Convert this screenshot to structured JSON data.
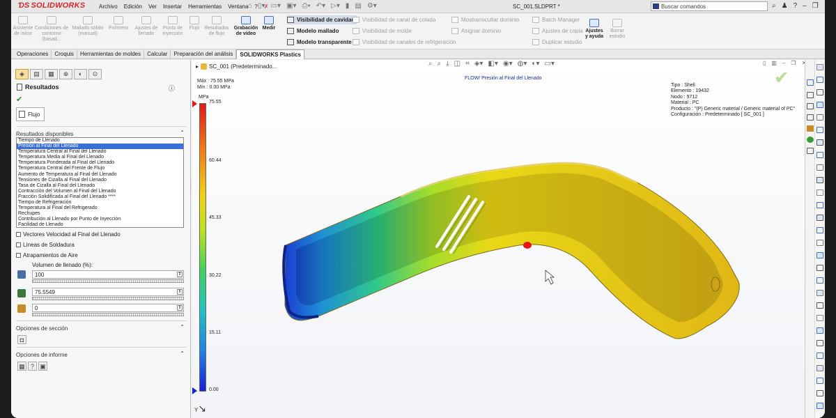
{
  "app": {
    "logo": "SOLIDWORKS",
    "menus": [
      "Archivo",
      "Edición",
      "Ver",
      "Insertar",
      "Herramientas",
      "Ventana",
      "?"
    ],
    "document_title": "SC_001.SLDPRT *",
    "command_search_placeholder": "Buscar comandos"
  },
  "ribbon": {
    "large_buttons": [
      {
        "label": "Asistente de inicio",
        "enabled": false
      },
      {
        "label": "Condiciones de contorno (basad...",
        "enabled": false
      },
      {
        "label": "Mallado sólido (manual)",
        "enabled": false
      },
      {
        "label": "Polímero",
        "enabled": false
      },
      {
        "label": "Ajustes de llenado",
        "enabled": false
      },
      {
        "label": "Punto de inyección",
        "enabled": false
      },
      {
        "label": "Flujo",
        "enabled": false
      },
      {
        "label": "Resultados de flujo",
        "enabled": false
      },
      {
        "label": "Grabación de vídeo",
        "enabled": true
      },
      {
        "label": "Medir",
        "enabled": true
      }
    ],
    "display_options": [
      {
        "label": "Visibilidad de cavidad",
        "enabled": true,
        "selected": true
      },
      {
        "label": "Modelo mallado",
        "enabled": true
      },
      {
        "label": "Modelo transparente",
        "enabled": true
      }
    ],
    "visibility_options": [
      {
        "label": "Visibilidad de canal de colada",
        "enabled": false
      },
      {
        "label": "Visibilidad de molde",
        "enabled": false
      },
      {
        "label": "Visibilidad de canales de refrigeración",
        "enabled": false
      }
    ],
    "domain_options": [
      {
        "label": "Mostrar/ocultar dominio",
        "enabled": false
      },
      {
        "label": "Asignar dominio",
        "enabled": false
      }
    ],
    "batch_options": [
      {
        "label": "Batch Manager",
        "enabled": false
      },
      {
        "label": "Ajustes de copia",
        "enabled": false
      },
      {
        "label": "Duplicar estudio",
        "enabled": false
      }
    ],
    "right_buttons": [
      {
        "label": "Ajustes y ayuda",
        "enabled": true
      },
      {
        "label": "Borrar estudio",
        "enabled": false
      }
    ]
  },
  "tabs": [
    {
      "label": "Operaciones",
      "active": false
    },
    {
      "label": "Croquis",
      "active": false
    },
    {
      "label": "Herramientas de moldes",
      "active": false
    },
    {
      "label": "Calcular",
      "active": false
    },
    {
      "label": "Preparación del análisis",
      "active": false
    },
    {
      "label": "SOLIDWORKS Plastics",
      "active": true
    }
  ],
  "panel": {
    "title": "Resultados",
    "help_icon": "question-icon",
    "ok_icon": "check-icon",
    "flow_tab": "Flujo",
    "results_section": "Resultados disponibles",
    "results": [
      "Tiempo de Llenado",
      "Presión al Final del Llenado",
      "Temperatura Central al Final del Llenado",
      "Temperatura Media al Final del Llenado",
      "Temperatura Ponderada al Final del Llenado",
      "Temperatura Central del Frente de Flujo",
      "Aumento de Temperatura al Final del Llenado",
      "Tensiones de Cizalla al Final del Llenado",
      "Tasa de Cizalla al Final del Llenado",
      "Contracción del Volumen al Final del Llenado",
      "Fracción Solidificada al Final del Llenado ****",
      "Tiempo de Refrigeración",
      "Temperatura al Final del Refrigerado",
      "Rechupes",
      "Contribución al Llenado por Punto de Inyección",
      "Facilidad de Llenado"
    ],
    "selected_result_index": 1,
    "checkboxes": [
      {
        "label": "Vectores Velocidad al Final del Llenado",
        "checked": false
      },
      {
        "label": "Líneas de Soldadura",
        "checked": false
      },
      {
        "label": "Atrapamientos de Aire",
        "checked": false
      }
    ],
    "fill_volume_label": "Volumen de llenado (%):",
    "fill_volume_value": "100",
    "pressure_value": "75.5549",
    "third_value": "0",
    "section_options": "Opciones de sección",
    "report_options": "Opciones de informe"
  },
  "viewport": {
    "tree_item": "SC_001  (Predeterminado...",
    "max_label": "Máx : 75.55 MPa",
    "min_label": "Mín : 0.00 MPa",
    "plot_title": "FLOW/ Presión al Final del Llenado",
    "mesh_info": [
      "Tipo : Shell",
      "Elemento : 19432",
      "Nodo : 9712",
      "Material : PC",
      "Producto :  \"(P)  Generic material / Generic material of PC\"",
      "Configuración : Predeterminado [ SC_001 ]"
    ],
    "scale_unit": "MPa",
    "scale_ticks": [
      "75.55",
      "60.44",
      "45.33",
      "30.22",
      "15.11",
      "0.00"
    ],
    "triad_label": "Y",
    "colors": {
      "max": "#e6171a",
      "mid": "#f2d311",
      "min": "#1422d8",
      "accent": "#3a6fd8"
    }
  }
}
